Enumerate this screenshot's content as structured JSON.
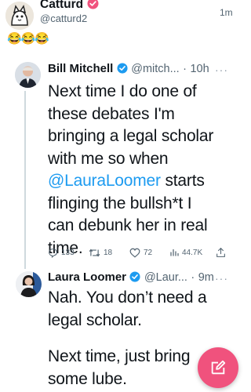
{
  "colors": {
    "accent": "#1d9bf0",
    "verified_blue": "#1d9bf0",
    "verified_red_badge": "#f0527d",
    "fab": "#f0527d",
    "muted": "#536471"
  },
  "header_tweet": {
    "display_name": "Catturd",
    "handle": "@catturd2",
    "time": "1m",
    "text": "😂😂😂"
  },
  "quoted_tweet_1": {
    "display_name": "Bill Mitchell",
    "handle": "@mitch...",
    "separator": "·",
    "time": "10h",
    "more": "···",
    "text_before_mention": "Next time I do one of these debates I'm bringing a legal scholar with me so when",
    "mention": "@LauraLoomer",
    "text_after_mention": "starts flinging the bullsh*t I can debunk her in real time.",
    "actions": {
      "replies": "133",
      "retweets": "18",
      "likes": "72",
      "views": "44.7K"
    }
  },
  "quoted_tweet_2": {
    "display_name": "Laura Loomer",
    "handle": "@Laur...",
    "separator": "·",
    "time": "9m",
    "more": "···",
    "text_line1": "Nah. You don’t need a legal scholar.",
    "text_line2": "Next time, just bring some lube."
  },
  "icons": [
    "cat-avatar",
    "verified-badge-icon",
    "reply-icon",
    "retweet-icon",
    "like-icon",
    "views-icon",
    "share-icon",
    "compose-icon"
  ]
}
